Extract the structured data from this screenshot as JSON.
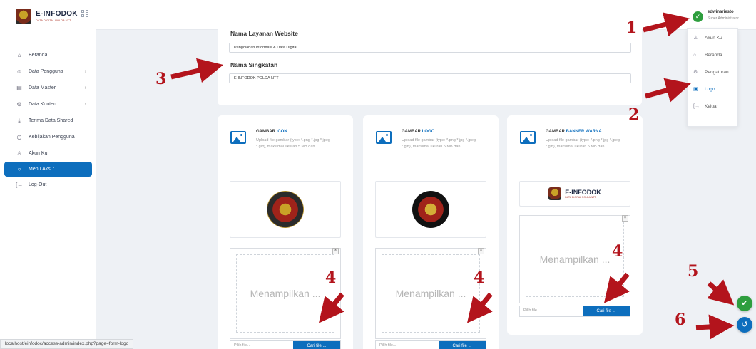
{
  "app": {
    "logo_title": "E-INFODOK",
    "logo_subtitle": "DATA DIGITAL POLDA NTT"
  },
  "sidebar": {
    "items": [
      {
        "label": "Beranda",
        "icon": "home-icon",
        "has_chevron": false
      },
      {
        "label": "Data Pengguna",
        "icon": "users-icon",
        "has_chevron": true
      },
      {
        "label": "Data Master",
        "icon": "database-icon",
        "has_chevron": true
      },
      {
        "label": "Data Konten",
        "icon": "gear-icon",
        "has_chevron": true
      },
      {
        "label": "Terima Data Shared",
        "icon": "download-icon",
        "has_chevron": false
      },
      {
        "label": "Kebijakan Pengguna",
        "icon": "policy-icon",
        "has_chevron": false
      },
      {
        "label": "Akun Ku",
        "icon": "user-icon",
        "has_chevron": false
      },
      {
        "label": "Menu Aksi :",
        "icon": "action-icon",
        "has_chevron": false,
        "active": true
      },
      {
        "label": "Log-Out",
        "icon": "logout-icon",
        "has_chevron": false
      }
    ]
  },
  "user": {
    "name": "edwinariesto",
    "role": "Super Administrator"
  },
  "dropdown": {
    "items": [
      {
        "label": "Akun Ku",
        "icon": "user-icon"
      },
      {
        "label": "Beranda",
        "icon": "home-icon"
      },
      {
        "label": "Pengaturan",
        "icon": "gear-icon"
      },
      {
        "label": "Logo",
        "icon": "image-icon",
        "active": true
      },
      {
        "label": "Keluar",
        "icon": "logout-icon"
      }
    ]
  },
  "form": {
    "service_label": "Nama Layanan Website",
    "service_value": "Pengolahan Informasi & Data Digital",
    "short_label": "Nama Singkatan",
    "short_value": "E-INFODOK POLDA NTT"
  },
  "cards": [
    {
      "title_prefix": "GAMBAR ",
      "title_highlight": "ICON",
      "desc": "Upload file gambar (type: *.png *.jpg *.jpeg *.giff), maksimal ukuran 5 MB dan",
      "preview_placeholder": "Menampilkan ...",
      "file_placeholder": "Pilih file...",
      "file_button": "Cari file ..."
    },
    {
      "title_prefix": "GAMBAR ",
      "title_highlight": "LOGO",
      "desc": "Upload file gambar (type: *.png *.jpg *.jpeg *.giff), maksimal ukuran 5 MB dan",
      "preview_placeholder": "Menampilkan ...",
      "file_placeholder": "Pilih file...",
      "file_button": "Cari file ..."
    },
    {
      "title_prefix": "GAMBAR ",
      "title_highlight": "BANNER WARNA",
      "desc": "Upload file gambar (type: *.png *.jpg *.jpeg *.giff), maksimal ukuran 5 MB dan",
      "preview_placeholder": "Menampilkan ...",
      "file_placeholder": "Pilih file...",
      "file_button": "Cari file ..."
    }
  ],
  "annotations": {
    "n1": "1",
    "n2": "2",
    "n3": "3",
    "n4a": "4",
    "n4b": "4",
    "n4c": "4",
    "n5": "5",
    "n6": "6"
  },
  "status_url": "localhost/einfodoc/access-admin/index.php?page=form-logo",
  "colors": {
    "accent": "#0d6ebd",
    "success": "#2e9e3e",
    "annotation": "#b3141c"
  }
}
